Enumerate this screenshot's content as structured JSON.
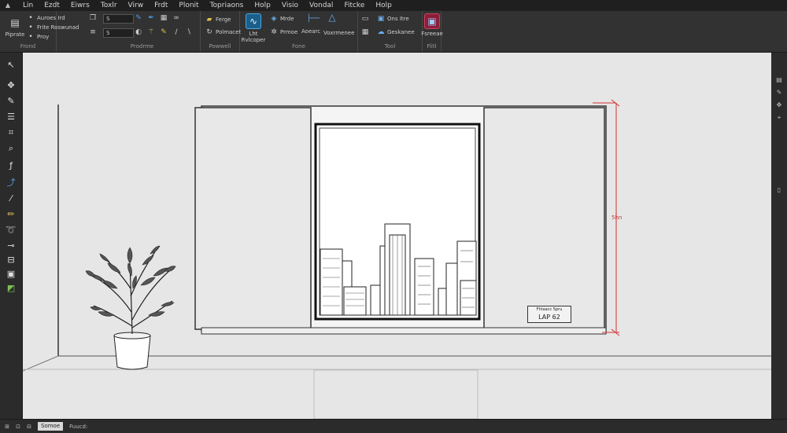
{
  "menu": {
    "items": [
      "Lin",
      "Ezdt",
      "Eiwrs",
      "Toxlr",
      "Virw",
      "Frdt",
      "Plonit",
      "Topriaons",
      "Holp",
      "Visio",
      "Vondal",
      "Fitcke",
      "Holp"
    ]
  },
  "ribbon": {
    "groups": {
      "g1": "Frond",
      "g2": "Prodrme",
      "g3": "Powwell",
      "g4": "Fone",
      "g5": "Tool",
      "g6": "Fiitl"
    },
    "g1": {
      "big1": "Piprate",
      "b1": "Auroes Ird",
      "b2": "Frite Roswunad",
      "b3": "Proy"
    },
    "g2": {
      "field1": "S",
      "field2": "S"
    },
    "g3": {
      "b1": "Ferge",
      "b2": "Polmacet"
    },
    "g4": {
      "big1": "Lht",
      "big1b": "Rvlcoper",
      "b1": "Mrde",
      "b2": "Prmoe",
      "b3": "Aoearc",
      "b4": "Voxrmenee"
    },
    "g5": {
      "b1": "Ons Itre",
      "b2": "Geskanee"
    },
    "g6": {
      "big1": "Fsreeae"
    }
  },
  "canvas": {
    "dimension_label": "5hn",
    "tag_line1": "Fhtaacc 5pru",
    "tag_line2": "LAP 62"
  },
  "status": {
    "field": "Somoe",
    "text": "Fuucd:"
  }
}
